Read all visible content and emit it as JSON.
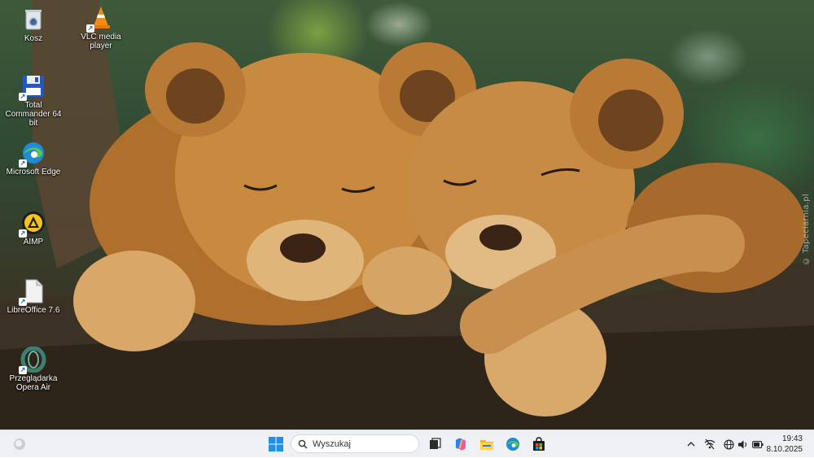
{
  "desktop": {
    "icons": [
      {
        "label": "Kosz",
        "icon": "recycle-bin-icon"
      },
      {
        "label": "VLC media player",
        "icon": "vlc-cone-icon"
      },
      {
        "label": "Total Commander 64 bit",
        "icon": "floppy-disk-icon"
      },
      {
        "label": "Microsoft Edge",
        "icon": "edge-icon"
      },
      {
        "label": "AIMP",
        "icon": "aimp-icon"
      },
      {
        "label": "LibreOffice 7.6",
        "icon": "document-icon"
      },
      {
        "label": "Przeglądarka Opera Air",
        "icon": "opera-icon"
      }
    ],
    "watermark": "© Tapeciarnia.pl"
  },
  "taskbar": {
    "search_placeholder": "Wyszukaj",
    "pinned": [
      "widgets-icon",
      "start-icon",
      "task-view-icon",
      "copilot-icon",
      "file-explorer-icon",
      "edge-icon",
      "store-icon"
    ],
    "tray": [
      "chevron-up-icon",
      "network-icon",
      "language-icon",
      "volume-icon",
      "battery-icon"
    ],
    "time": "19:43",
    "date": "8.10.2025"
  },
  "colors": {
    "taskbar_bg": "#eef0f4",
    "accent": "#0a6cd6"
  }
}
